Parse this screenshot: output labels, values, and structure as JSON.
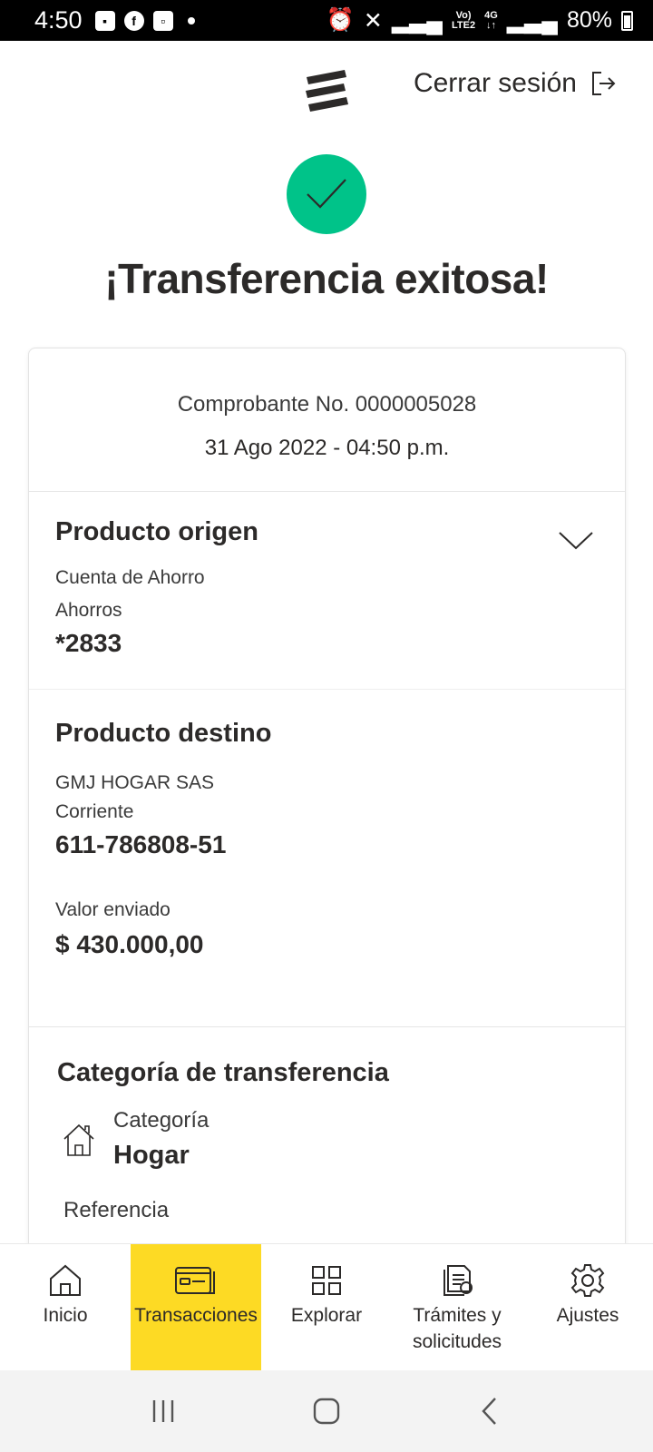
{
  "status_bar": {
    "time": "4:50",
    "battery": "80%"
  },
  "header": {
    "logout_label": "Cerrar sesión"
  },
  "success": {
    "title": "¡Transferencia exitosa!",
    "color": "#00c389"
  },
  "voucher": {
    "number": "Comprobante No. 0000005028",
    "date": "31 Ago 2022 - 04:50 p.m."
  },
  "origin": {
    "title": "Producto origen",
    "account_type": "Cuenta de Ahorro",
    "account_subtype": "Ahorros",
    "account_number": "*2833"
  },
  "destination": {
    "title": "Producto destino",
    "name": "GMJ HOGAR SAS",
    "account_type": "Corriente",
    "account_number": "611-786808-51",
    "amount_label": "Valor enviado",
    "amount": "$ 430.000,00"
  },
  "category": {
    "title": "Categoría de transferencia",
    "label": "Categoría",
    "value": "Hogar",
    "reference_label": "Referencia"
  },
  "bottom_nav": {
    "active_color": "#fdda24",
    "items": [
      {
        "label": "Inicio",
        "icon": "home-icon"
      },
      {
        "label": "Transacciones",
        "icon": "transactions-icon",
        "active": true
      },
      {
        "label": "Explorar",
        "icon": "grid-icon"
      },
      {
        "label": "Trámites y solicitudes",
        "icon": "documents-icon"
      },
      {
        "label": "Ajustes",
        "icon": "gear-icon"
      }
    ]
  }
}
